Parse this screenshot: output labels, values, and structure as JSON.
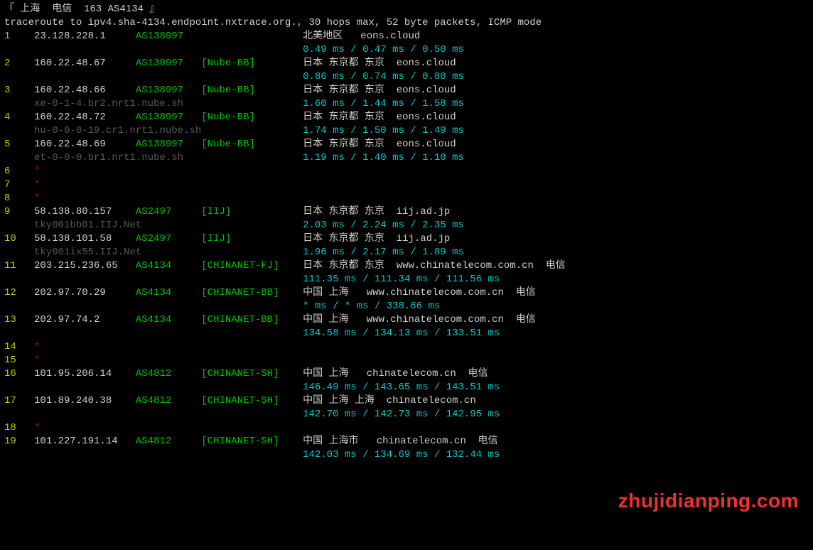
{
  "header": {
    "title": "『 上海  电信  163 AS4134 』",
    "subtitle": "traceroute to ipv4.sha-4134.endpoint.nxtrace.org., 30 hops max, 52 byte packets, ICMP mode"
  },
  "cols": {
    "hop": 5,
    "ip": 17,
    "asn": 11,
    "tag": 17
  },
  "hops": [
    {
      "n": "1",
      "ip": "23.128.228.1",
      "asn": "AS138997",
      "tag": "",
      "loc": "北美地区   eons.cloud",
      "rtt": "0.49 ms / 0.47 ms / 0.50 ms",
      "rdns": ""
    },
    {
      "n": "2",
      "ip": "160.22.48.67",
      "asn": "AS138997",
      "tag": "[Nube-BB]",
      "loc": "日本 东京都 东京  eons.cloud",
      "rtt": "0.86 ms / 0.74 ms / 0.80 ms",
      "rdns": ""
    },
    {
      "n": "3",
      "ip": "160.22.48.66",
      "asn": "AS138997",
      "tag": "[Nube-BB]",
      "loc": "日本 东京都 东京  eons.cloud",
      "rtt": "1.60 ms / 1.44 ms / 1.58 ms",
      "rdns": "xe-0-1-4.br2.nrt1.nube.sh"
    },
    {
      "n": "4",
      "ip": "160.22.48.72",
      "asn": "AS138997",
      "tag": "[Nube-BB]",
      "loc": "日本 东京都 东京  eons.cloud",
      "rtt": "1.74 ms / 1.50 ms / 1.49 ms",
      "rdns": "hu-0-0-0-19.cr1.nrt1.nube.sh"
    },
    {
      "n": "5",
      "ip": "160.22.48.69",
      "asn": "AS138997",
      "tag": "[Nube-BB]",
      "loc": "日本 东京都 东京  eons.cloud",
      "rtt": "1.19 ms / 1.40 ms / 1.10 ms",
      "rdns": "et-0-0-0.br1.nrt1.nube.sh"
    },
    {
      "n": "6",
      "ip": "*"
    },
    {
      "n": "7",
      "ip": "*"
    },
    {
      "n": "8",
      "ip": "*"
    },
    {
      "n": "9",
      "ip": "58.138.80.157",
      "asn": "AS2497",
      "tag": "[IIJ]",
      "loc": "日本 东京都 东京  iij.ad.jp",
      "rtt": "2.03 ms / 2.24 ms / 2.35 ms",
      "rdns": "tky001bb01.IIJ.Net"
    },
    {
      "n": "10",
      "ip": "58.138.101.58",
      "asn": "AS2497",
      "tag": "[IIJ]",
      "loc": "日本 东京都 东京  iij.ad.jp",
      "rtt": "1.96 ms / 2.17 ms / 1.89 ms",
      "rdns": "tky001ix55.IIJ.Net"
    },
    {
      "n": "11",
      "ip": "203.215.236.65",
      "asn": "AS4134",
      "tag": "[CHINANET-FJ]",
      "loc": "日本 东京都 东京  www.chinatelecom.com.cn  电信",
      "rtt": "111.35 ms / 111.34 ms / 111.56 ms",
      "rdns": ""
    },
    {
      "n": "12",
      "ip": "202.97.70.29",
      "asn": "AS4134",
      "tag": "[CHINANET-BB]",
      "loc": "中国 上海   www.chinatelecom.com.cn  电信",
      "rtt": "* ms / * ms / 338.66 ms",
      "rdns": ""
    },
    {
      "n": "13",
      "ip": "202.97.74.2",
      "asn": "AS4134",
      "tag": "[CHINANET-BB]",
      "loc": "中国 上海   www.chinatelecom.com.cn  电信",
      "rtt": "134.58 ms / 134.13 ms / 133.51 ms",
      "rdns": ""
    },
    {
      "n": "14",
      "ip": "*"
    },
    {
      "n": "15",
      "ip": "*"
    },
    {
      "n": "16",
      "ip": "101.95.206.14",
      "asn": "AS4812",
      "tag": "[CHINANET-SH]",
      "loc": "中国 上海   chinatelecom.cn  电信",
      "rtt": "146.49 ms / 143.65 ms / 143.51 ms",
      "rdns": ""
    },
    {
      "n": "17",
      "ip": "101.89.240.38",
      "asn": "AS4812",
      "tag": "[CHINANET-SH]",
      "loc": "中国 上海 上海  chinatelecom.cn",
      "rtt": "142.70 ms / 142.73 ms / 142.95 ms",
      "rdns": ""
    },
    {
      "n": "18",
      "ip": "*"
    },
    {
      "n": "19",
      "ip": "101.227.191.14",
      "asn": "AS4812",
      "tag": "[CHINANET-SH]",
      "loc": "中国 上海市   chinatelecom.cn  电信",
      "rtt": "142.03 ms / 134.69 ms / 132.44 ms",
      "rdns": ""
    }
  ],
  "watermark": "zhujidianping.com"
}
